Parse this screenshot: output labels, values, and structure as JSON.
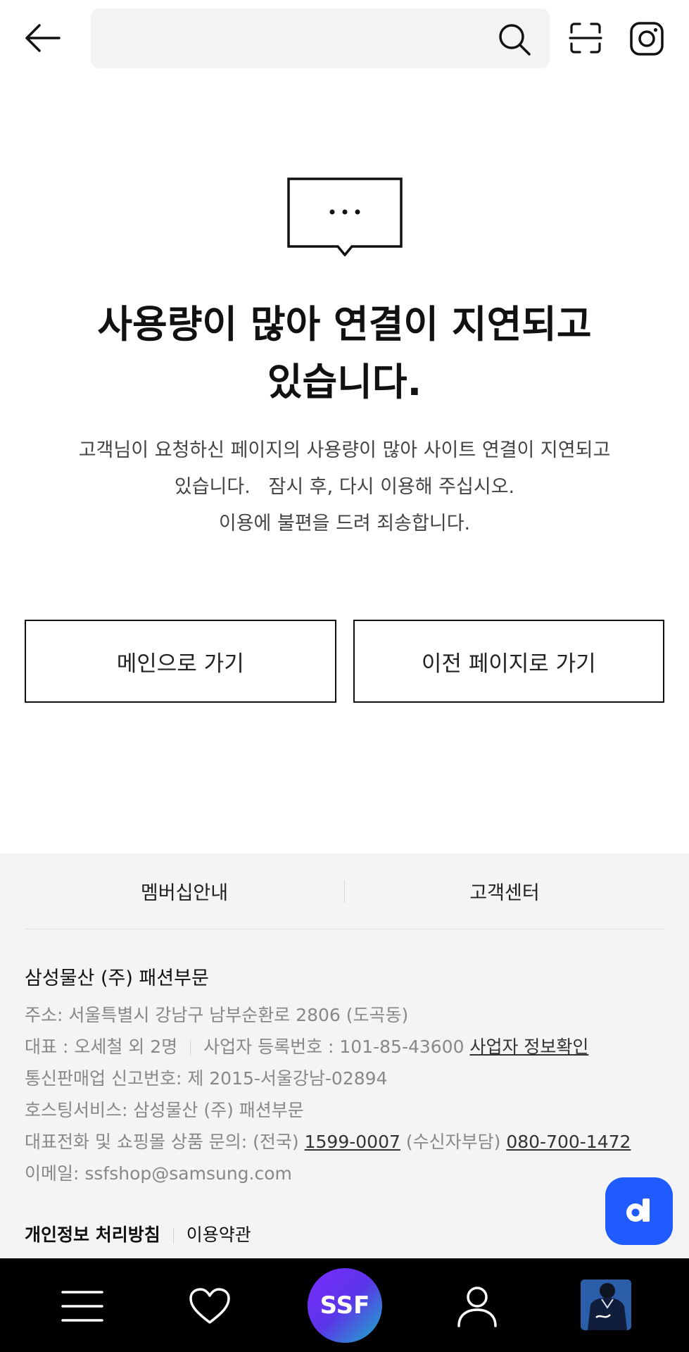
{
  "header": {
    "search_placeholder": ""
  },
  "error": {
    "title_line1": "사용량이 많아 연결이 지연되고",
    "title_line2": "있습니다.",
    "desc_line1": "고객님이 요청하신 페이지의 사용량이 많아 사이트 연결이 지연되고",
    "desc_line2": "있습니다.   잠시 후, 다시 이용해 주십시오.",
    "desc_line3": "이용에 불편을 드려 죄송합니다.",
    "bubble_text": "···"
  },
  "buttons": {
    "main": "메인으로 가기",
    "prev": "이전 페이지로 가기"
  },
  "footer": {
    "link_membership": "멤버십안내",
    "link_cs": "고객센터",
    "company": "삼성물산 (주) 패션부문",
    "address": "주소: 서울특별시 강남구 남부순환로 2806 (도곡동)",
    "ceo": "대표 : 오세철 외 2명",
    "biz_no": "사업자 등록번호 : 101-85-43600",
    "biz_check": "사업자 정보확인",
    "mail_order": "통신판매업 신고번호: 제 2015-서울강남-02894",
    "hosting": "호스팅서비스: 삼성물산 (주) 패션부문",
    "phone_label": "대표전화 및 쇼핑몰 상품 문의: (전국)",
    "phone1": "1599-0007",
    "phone_free_label": "(수신자부담)",
    "phone2": "080-700-1472",
    "email": "이메일: ssfshop@samsung.com",
    "privacy": "개인정보 처리방침",
    "terms": "이용약관"
  },
  "floating": {
    "label": "d"
  },
  "nav": {
    "ssf": "SSF"
  },
  "colors": {
    "float_button": "#1f5bff",
    "nav_bg": "#000000",
    "footer_bg": "#f4f4f4"
  }
}
